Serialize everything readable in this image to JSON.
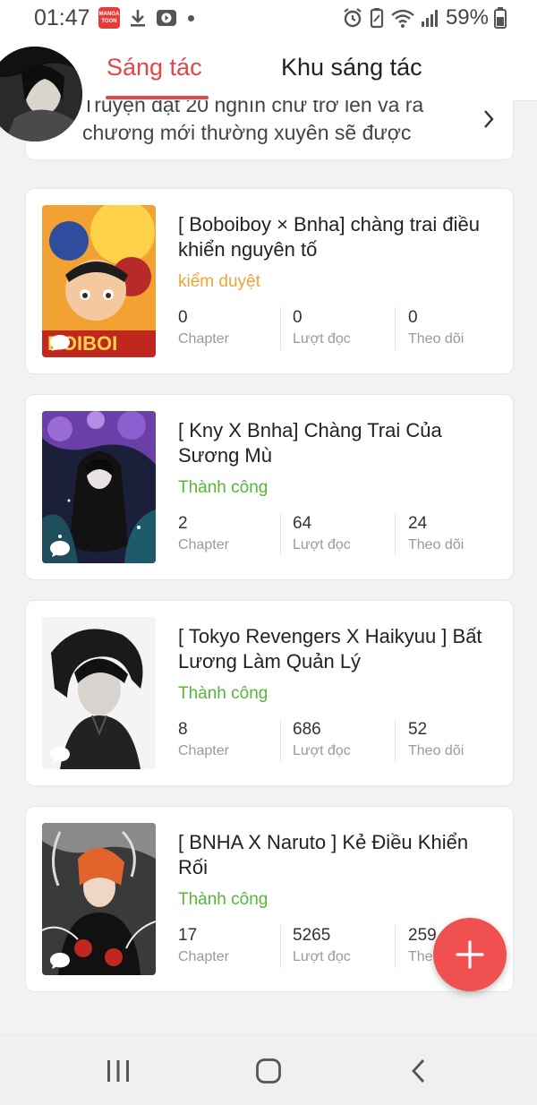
{
  "status_bar": {
    "time": "01:47",
    "app_badge_line1": "MANGA",
    "app_badge_line2": "TOON",
    "battery": "59%",
    "icons": [
      "mangatoon-icon",
      "download-icon",
      "youtube-icon",
      "alarm-icon",
      "battery-saver-icon",
      "wifi-icon",
      "signal-icon",
      "battery-icon"
    ]
  },
  "header": {
    "tabs": [
      {
        "label": "Sáng tác",
        "active": true
      },
      {
        "label": "Khu sáng tác",
        "active": false
      }
    ]
  },
  "notice": {
    "text": "Truyện đạt 20 nghìn chữ trở lên và ra chương mới thường xuyên sẽ được"
  },
  "colors": {
    "accent": "#e64545",
    "status_pending": "#f0a23a",
    "status_success": "#55b737"
  },
  "stories": [
    {
      "title": "[ Boboiboy × Bnha] chàng trai điều khiển nguyên tố",
      "status": "kiểm duyệt",
      "status_type": "pending",
      "chapters": "0",
      "reads": "0",
      "follows": "0"
    },
    {
      "title": "[ Kny X Bnha] Chàng Trai Của Sương Mù",
      "status": "Thành công",
      "status_type": "success",
      "chapters": "2",
      "reads": "64",
      "follows": "24"
    },
    {
      "title": "[ Tokyo Revengers X Haikyuu ] Bất Lương Làm Quản Lý",
      "status": "Thành công",
      "status_type": "success",
      "chapters": "8",
      "reads": "686",
      "follows": "52"
    },
    {
      "title": "[ BNHA X Naruto ] Kẻ Điều Khiển Rối",
      "status": "Thành công",
      "status_type": "success",
      "chapters": "17",
      "reads": "5265",
      "follows": "259"
    }
  ],
  "labels": {
    "chapter": "Chapter",
    "reads": "Lượt đọc",
    "follows": "Theo dõi",
    "follows_truncated": "The"
  },
  "nav": {
    "buttons": [
      "recent-apps-icon",
      "home-icon",
      "back-icon"
    ]
  }
}
